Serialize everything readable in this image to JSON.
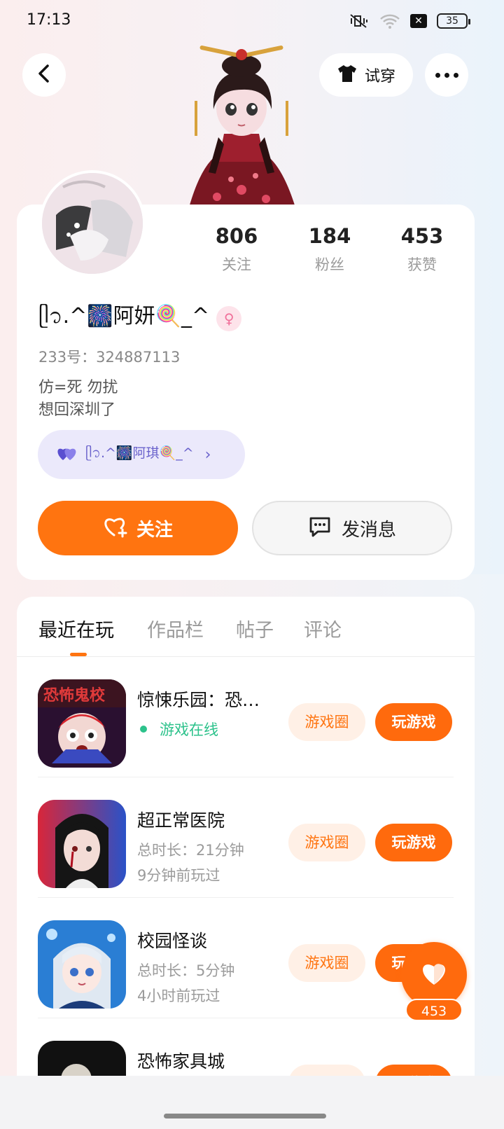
{
  "status_bar": {
    "time": "17:13",
    "battery": "35",
    "icons": [
      "mute-vibrate-icon",
      "wifi-icon",
      "close-box-icon",
      "battery-icon"
    ]
  },
  "header": {
    "tryon_label": "试穿"
  },
  "profile": {
    "stats": [
      {
        "value": "806",
        "label": "关注"
      },
      {
        "value": "184",
        "label": "粉丝"
      },
      {
        "value": "453",
        "label": "获赞"
      }
    ],
    "nickname": "ᥫ᭡.^🎆阿妍🍭_^",
    "uid": "233号：324887113",
    "bio_line1": "仿=死   勿扰",
    "bio_line2": "想回深圳了",
    "cp_tag": "ᥫ᭡.^🎆阿琪🍭_^",
    "follow_label": "关注",
    "message_label": "发消息"
  },
  "tabs": [
    {
      "label": "最近在玩",
      "active": true
    },
    {
      "label": "作品栏",
      "active": false
    },
    {
      "label": "帖子",
      "active": false
    },
    {
      "label": "评论",
      "active": false
    }
  ],
  "games": [
    {
      "name": "惊悚乐园：恐怖鬼校",
      "status": "游戏在线",
      "line2": "",
      "circle": "游戏圈",
      "play": "玩游戏"
    },
    {
      "name": "超正常医院",
      "status": "",
      "line1": "总时长：21分钟",
      "line2": "9分钟前玩过",
      "circle": "游戏圈",
      "play": "玩游戏"
    },
    {
      "name": "校园怪谈",
      "status": "",
      "line1": "总时长：5分钟",
      "line2": "4小时前玩过",
      "circle": "游戏圈",
      "play": "玩游戏"
    },
    {
      "name": "恐怖家具城",
      "status": "",
      "line1": "",
      "line2": "",
      "circle": "游戏圈",
      "play": "玩游戏"
    }
  ],
  "fab": {
    "count": "453"
  },
  "colors": {
    "accent": "#ff7410",
    "online": "#2cc28b",
    "cp_bg": "#ebe9fb"
  }
}
